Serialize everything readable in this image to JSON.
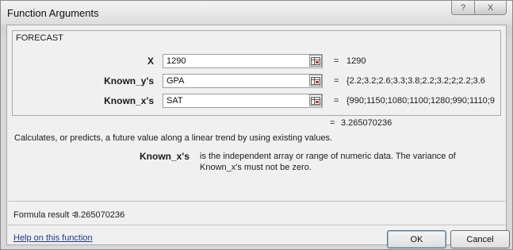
{
  "window": {
    "title": "Function Arguments",
    "help_glyph": "?",
    "close_glyph": "X"
  },
  "function": {
    "name": "FORECAST",
    "arguments": [
      {
        "label": "X",
        "input": "1290",
        "value": "1290"
      },
      {
        "label": "Known_y's",
        "input": "GPA",
        "value": "{2.2;3.2;2.6;3.3;3.8;2.2;3.2;2;2.2;3.6"
      },
      {
        "label": "Known_x's",
        "input": "SAT",
        "value": "{990;1150;1080;1100;1280;990;1110;9"
      }
    ],
    "equals": "=",
    "result": "3.265070236",
    "description": "Calculates, or predicts, a future value along a linear trend by using existing values.",
    "param_name": "Known_x's",
    "param_description": "is the independent array or range of numeric data. The variance of Known_x's must not be zero."
  },
  "footer": {
    "formula_label": "Formula result =",
    "formula_value": "3.265070236",
    "help_link": "Help on this function",
    "ok_label": "OK",
    "cancel_label": "Cancel"
  }
}
